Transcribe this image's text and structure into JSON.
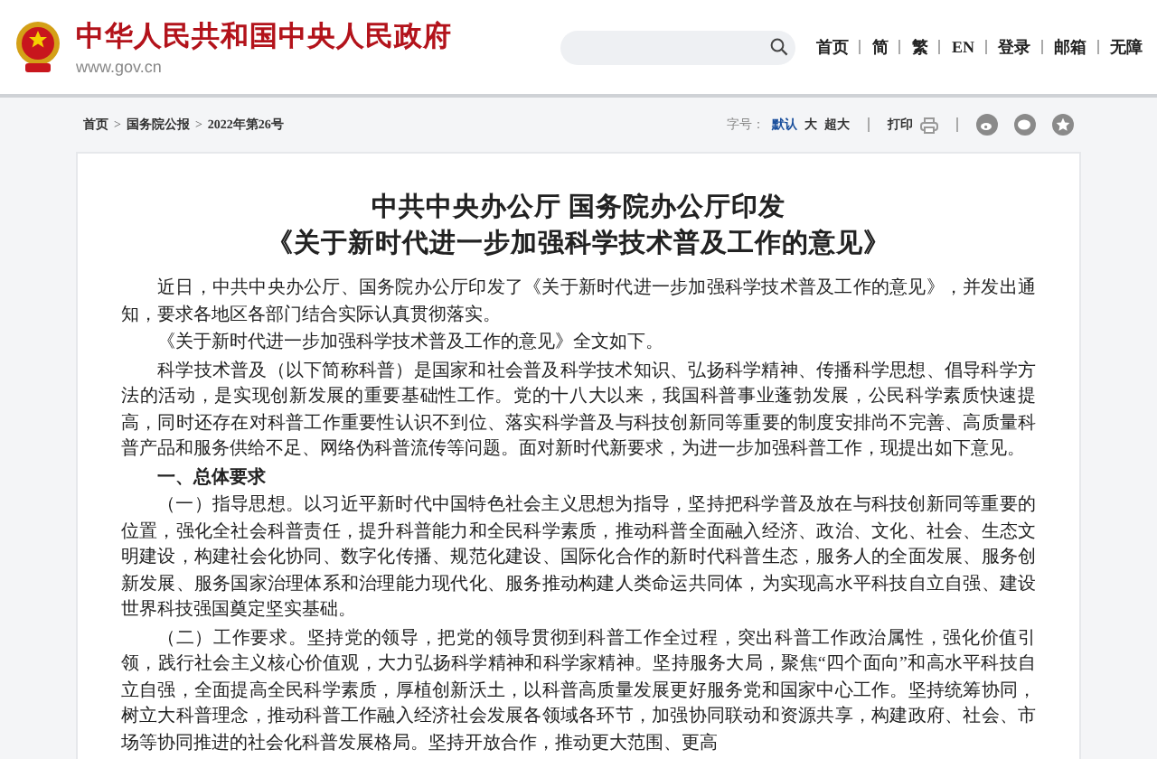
{
  "header": {
    "site_title": "中华人民共和国中央人民政府",
    "site_url": "www.gov.cn",
    "nav_links": [
      "首页",
      "简",
      "繁",
      "EN",
      "登录",
      "邮箱",
      "无障"
    ]
  },
  "breadcrumb": [
    {
      "kind": "link",
      "text": "首页"
    },
    {
      "kind": "separator",
      "text": ">"
    },
    {
      "kind": "link",
      "text": "国务院公报"
    },
    {
      "kind": "separator",
      "text": ">"
    },
    {
      "kind": "link",
      "text": "2022年第26号"
    }
  ],
  "toolbar": {
    "font_size_label": "字号：",
    "font_sizes": [
      {
        "label": "默认",
        "selected": true
      },
      {
        "label": "大",
        "selected": false
      },
      {
        "label": "超大",
        "selected": false
      }
    ],
    "print_label": "打印"
  },
  "article": {
    "title_lines": [
      "中共中央办公厅 国务院办公厅印发",
      "《关于新时代进一步加强科学技术普及工作的意见》"
    ],
    "paragraphs": [
      {
        "kind": "text",
        "text": "近日，中共中央办公厅、国务院办公厅印发了《关于新时代进一步加强科学技术普及工作的意见》，并发出通知，要求各地区各部门结合实际认真贯彻落实。"
      },
      {
        "kind": "text",
        "text": "《关于新时代进一步加强科学技术普及工作的意见》全文如下。"
      },
      {
        "kind": "text",
        "text": "科学技术普及（以下简称科普）是国家和社会普及科学技术知识、弘扬科学精神、传播科学思想、倡导科学方法的活动，是实现创新发展的重要基础性工作。党的十八大以来，我国科普事业蓬勃发展，公民科学素质快速提高，同时还存在对科普工作重要性认识不到位、落实科学普及与科技创新同等重要的制度安排尚不完善、高质量科普产品和服务供给不足、网络伪科普流传等问题。面对新时代新要求，为进一步加强科普工作，现提出如下意见。"
      },
      {
        "kind": "heading",
        "text": "一、总体要求"
      },
      {
        "kind": "text",
        "text": "（一）指导思想。以习近平新时代中国特色社会主义思想为指导，坚持把科学普及放在与科技创新同等重要的位置，强化全社会科普责任，提升科普能力和全民科学素质，推动科普全面融入经济、政治、文化、社会、生态文明建设，构建社会化协同、数字化传播、规范化建设、国际化合作的新时代科普生态，服务人的全面发展、服务创新发展、服务国家治理体系和治理能力现代化、服务推动构建人类命运共同体，为实现高水平科技自立自强、建设世界科技强国奠定坚实基础。"
      },
      {
        "kind": "text",
        "text": "（二）工作要求。坚持党的领导，把党的领导贯彻到科普工作全过程，突出科普工作政治属性，强化价值引领，践行社会主义核心价值观，大力弘扬科学精神和科学家精神。坚持服务大局，聚焦“四个面向”和高水平科技自立自强，全面提高全民科学素质，厚植创新沃土，以科普高质量发展更好服务党和国家中心工作。坚持统筹协同，树立大科普理念，推动科普工作融入经济社会发展各领域各环节，加强协同联动和资源共享，构建政府、社会、市场等协同推进的社会化科普发展格局。坚持开放合作，推动更大范围、更高"
      }
    ]
  }
}
